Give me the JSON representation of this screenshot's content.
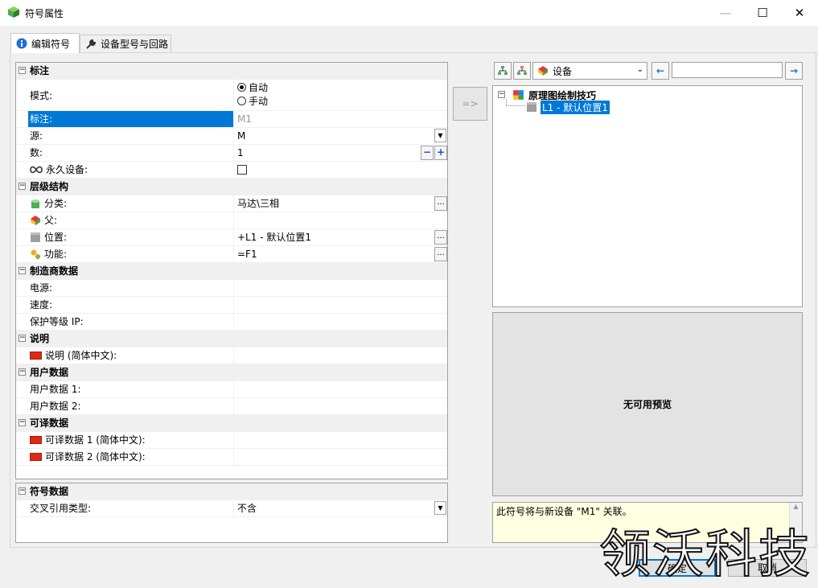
{
  "window": {
    "title": "符号属性",
    "minimize": "—",
    "maximize": "☐",
    "close": "✕"
  },
  "tabs": [
    {
      "label": "编辑符号",
      "icon": "info-icon",
      "active": true
    },
    {
      "label": "设备型号与回路",
      "icon": "wrench-icon",
      "active": false
    }
  ],
  "properties": {
    "cat_annotation": "标注",
    "mode_label": "模式:",
    "mode_auto": "自动",
    "mode_manual": "手动",
    "tag_label": "标注:",
    "tag_value": "M1",
    "source_label": "源:",
    "source_value": "M",
    "count_label": "数:",
    "count_value": "1",
    "stepper_minus": "−",
    "stepper_plus": "+",
    "permanent_label": "永久设备:",
    "cat_hierarchy": "层级结构",
    "class_label": "分类:",
    "class_value": "马达\\三相",
    "parent_label": "父:",
    "parent_value": "",
    "location_label": "位置:",
    "location_value": "+L1 - 默认位置1",
    "function_label": "功能:",
    "function_value": "=F1",
    "cat_manufacturer": "制造商数据",
    "power_label": "电源:",
    "speed_label": "速度:",
    "ip_label": "保护等级 IP:",
    "cat_description": "说明",
    "desc_label": "说明 (简体中文):",
    "cat_userdata": "用户数据",
    "user1_label": "用户数据 1:",
    "user2_label": "用户数据 2:",
    "cat_translatable": "可译数据",
    "trans1_label": "可译数据 1 (简体中文):",
    "trans2_label": "可译数据 2 (简体中文):",
    "ellipsis": "..."
  },
  "symbol_data": {
    "cat": "符号数据",
    "xref_label": "交叉引用类型:",
    "xref_value": "不含"
  },
  "assign_button": "=>",
  "tree_toolbar": {
    "filter_value": "设备",
    "search_placeholder": ""
  },
  "tree": {
    "root": "原理图绘制技巧",
    "child": "L1 - 默认位置1"
  },
  "preview_text": "无可用预览",
  "info_text": "此符号将与新设备 \"M1\" 关联。",
  "buttons": {
    "ok": "确定",
    "cancel": "取消"
  },
  "watermark": "领沃科技",
  "colors": {
    "selection": "#0078d7",
    "flag_red": "#de2910",
    "info_bg": "#ffffe1"
  }
}
